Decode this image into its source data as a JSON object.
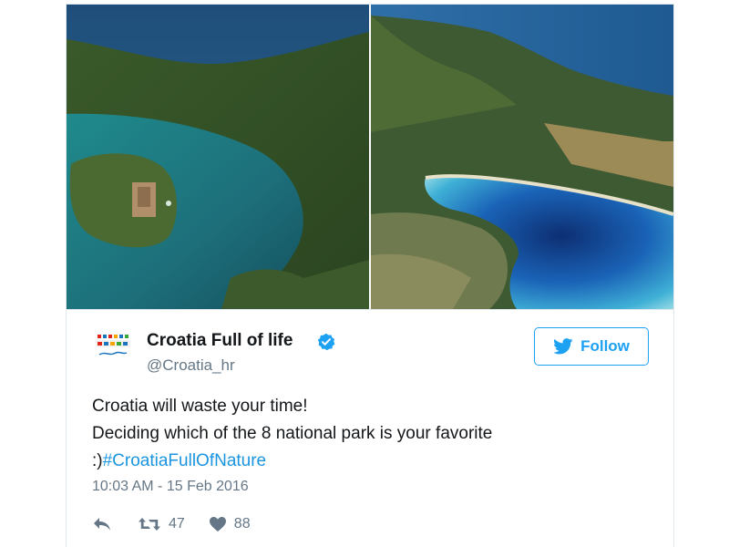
{
  "tweet": {
    "display_name": "Croatia Full of life",
    "handle": "@Croatia_hr",
    "verified": true,
    "follow_label": "Follow",
    "text_line1": "Croatia will waste your time!",
    "text_line2": "Deciding which of the 8 national park is your favorite",
    "text_prefix": ":)",
    "hashtag": "#CroatiaFullOfNature",
    "timestamp": "10:03 AM - 15 Feb 2016",
    "retweet_count": "47",
    "like_count": "88"
  },
  "icons": {
    "reply": "reply-icon",
    "retweet": "retweet-icon",
    "like": "heart-icon",
    "follow": "twitter-bird-icon",
    "verified": "verified-badge-icon"
  },
  "colors": {
    "accent": "#1da1f2",
    "hashtag": "#1b95e0",
    "muted": "#657786",
    "text": "#14171a"
  }
}
